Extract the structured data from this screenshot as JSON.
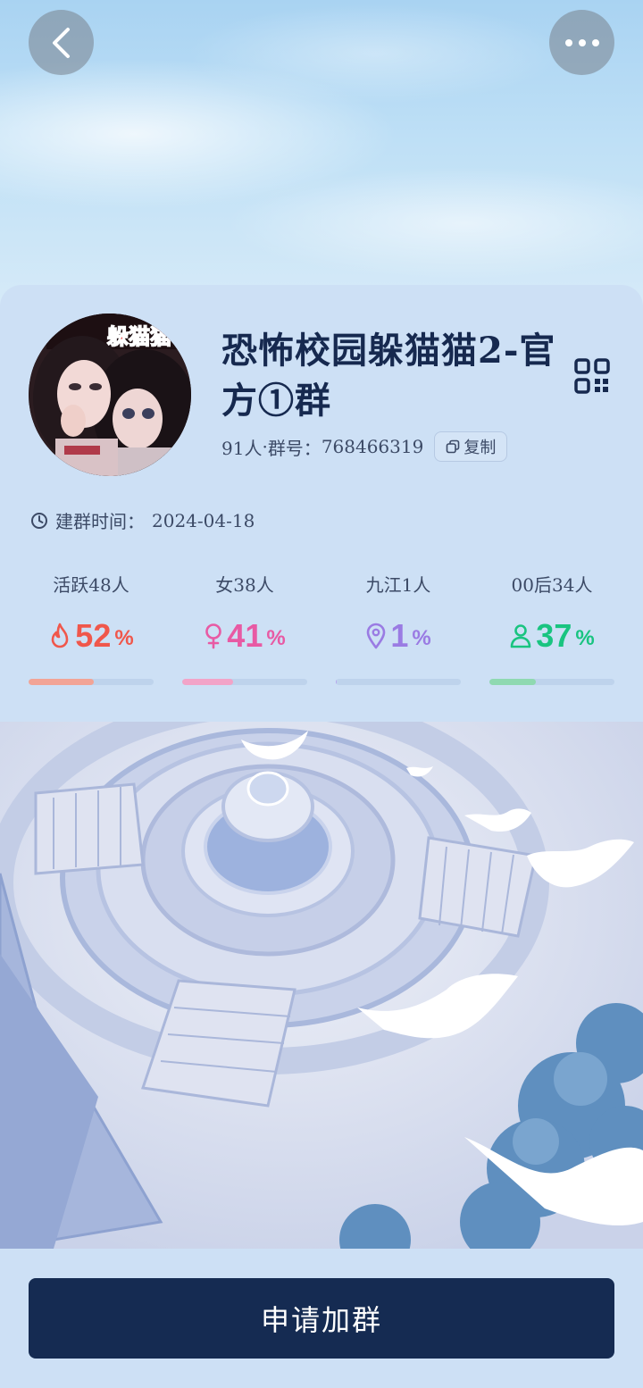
{
  "group": {
    "name": "恐怖校园躲猫猫2-官方①群",
    "members": "91人",
    "separator": "·",
    "id_label": "群号：",
    "id": "768466319",
    "copy_label": "复制",
    "created_label": "建群时间：",
    "created_date": "2024-04-18",
    "avatar_text": "躲猫猫"
  },
  "stats": [
    {
      "label": "活跃48人",
      "value": "52",
      "unit": "%",
      "icon": "flame-icon",
      "color": "#f0574b",
      "bar_color": "#f2a496",
      "fraction": 0.52
    },
    {
      "label": "女38人",
      "value": "41",
      "unit": "%",
      "icon": "female-icon",
      "color": "#e85aa4",
      "bar_color": "#f2a4c8",
      "fraction": 0.41
    },
    {
      "label": "九江1人",
      "value": "1",
      "unit": "%",
      "icon": "location-icon",
      "color": "#9a7be3",
      "bar_color": "#b8a6ee",
      "fraction": 0.01
    },
    {
      "label": "00后34人",
      "value": "37",
      "unit": "%",
      "icon": "person-icon",
      "color": "#19c480",
      "bar_color": "#8fd9b1",
      "fraction": 0.37
    }
  ],
  "actions": {
    "join_label": "申请加群"
  },
  "colors": {
    "primary": "#152b52",
    "card_bg": "#cde0f5"
  }
}
